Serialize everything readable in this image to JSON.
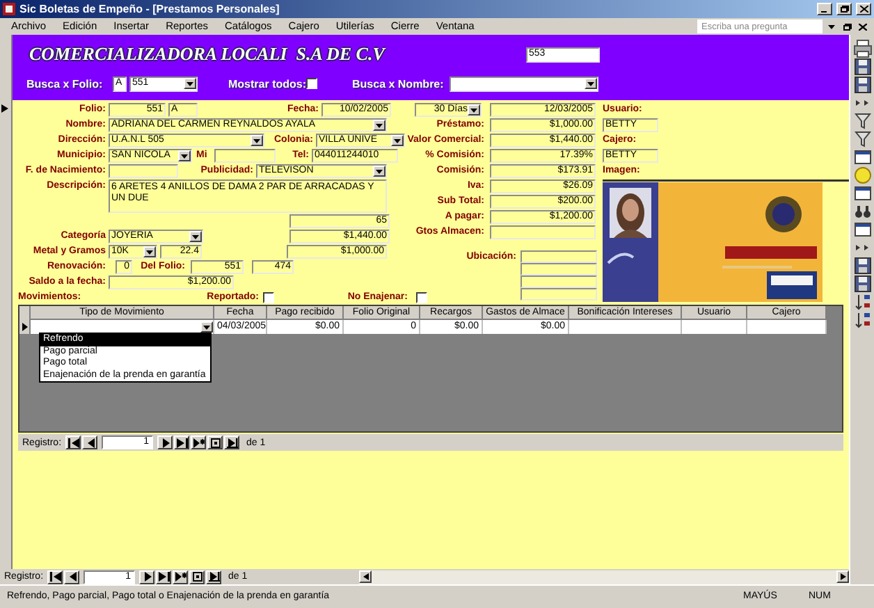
{
  "window": {
    "title": "Sic Boletas de Empeño - [Prestamos Personales]"
  },
  "menu": [
    "Archivo",
    "Edición",
    "Insertar",
    "Reportes",
    "Catálogos",
    "Cajero",
    "Utilerías",
    "Cierre",
    "Ventana"
  ],
  "help_box": {
    "placeholder": "Escriba una pregunta"
  },
  "header": {
    "company": "COMERCIALIZADORA LOCALI  S.A DE C.V",
    "record_number": "553",
    "folio_label": "Busca x Folio:",
    "folio_series": "A",
    "folio_value": "551",
    "show_all_label": "Mostrar todos:",
    "show_all_checked": false,
    "name_label": "Busca x Nombre:"
  },
  "form": {
    "left_rows": [
      [
        {
          "kind": "label",
          "text": "Folio:"
        },
        {
          "kind": "field",
          "value": "551"
        },
        {
          "kind": "field",
          "value": "A"
        },
        {
          "kind": "label",
          "text": "Fecha:"
        },
        {
          "kind": "field",
          "value": "10/02/2005"
        }
      ],
      [
        {
          "kind": "label",
          "text": "Nombre:"
        },
        {
          "kind": "combo",
          "value": "ADRIANA DEL CARMEN REYNALDOS AYALA"
        }
      ],
      [
        {
          "kind": "label",
          "text": "Dirección:"
        },
        {
          "kind": "combo",
          "value": "U.A.N.L 505"
        },
        {
          "kind": "label",
          "text": "Colonia:"
        },
        {
          "kind": "combo",
          "value": "VILLA UNIVE"
        }
      ],
      [
        {
          "kind": "label",
          "text": "Municipio:"
        },
        {
          "kind": "combo",
          "value": "SAN NICOLA"
        },
        {
          "kind": "label",
          "text": "Mi"
        },
        {
          "kind": "field"
        },
        {
          "kind": "label",
          "text": "Tel:"
        },
        {
          "kind": "field",
          "value": "044011244010"
        }
      ],
      [
        {
          "kind": "label",
          "text": "F. de Nacimiento:"
        },
        {
          "kind": "field"
        },
        {
          "kind": "label",
          "text": "Publicidad:"
        },
        {
          "kind": "combo",
          "value": "TELEVISON"
        }
      ],
      [
        {
          "kind": "label",
          "text": "Descripción:"
        },
        {
          "kind": "memo",
          "value": "6 ARETES 4 ANILLOS DE DAMA 2 PAR DE ARRACADAS Y UN DUE"
        }
      ],
      [
        {
          "kind": "field",
          "value": "65"
        }
      ],
      [
        {
          "kind": "label",
          "text": "Categoría"
        },
        {
          "kind": "combo",
          "value": "JOYERIA"
        },
        {
          "kind": "field",
          "value": "$1,440.00"
        }
      ],
      [
        {
          "kind": "label",
          "text": "Metal y Gramos"
        },
        {
          "kind": "combo",
          "value": "10K"
        },
        {
          "kind": "field",
          "value": "22.4"
        },
        {
          "kind": "field",
          "value": "$1,000.00"
        }
      ],
      [
        {
          "kind": "label",
          "text": "Renovación:"
        },
        {
          "kind": "field",
          "value": "0"
        },
        {
          "kind": "label",
          "text": "Del Folio:"
        },
        {
          "kind": "field",
          "value": "551"
        },
        {
          "kind": "field",
          "value": "474"
        }
      ],
      [
        {
          "kind": "label",
          "text": "Saldo a la fecha:"
        },
        {
          "kind": "field",
          "value": "$1,200.00"
        }
      ]
    ],
    "middle_rows": [
      [
        {
          "kind": "combo",
          "value": "30 Días"
        },
        {
          "kind": "field",
          "value": "12/03/2005"
        }
      ],
      [
        {
          "kind": "label",
          "text": "Préstamo:"
        },
        {
          "kind": "field",
          "value": "$1,000.00"
        }
      ],
      [
        {
          "kind": "label",
          "text": "Valor Comercial:"
        },
        {
          "kind": "field",
          "value": "$1,440.00"
        }
      ],
      [
        {
          "kind": "label",
          "text": "% Comisión:"
        },
        {
          "kind": "field",
          "value": "17.39%"
        }
      ],
      [
        {
          "kind": "label",
          "text": "Comisión:"
        },
        {
          "kind": "field",
          "value": "$173.91"
        }
      ],
      [
        {
          "kind": "label",
          "text": "Iva:"
        },
        {
          "kind": "field",
          "value": "$26.09"
        }
      ],
      [
        {
          "kind": "label",
          "text": "Sub Total:"
        },
        {
          "kind": "field",
          "value": "$200.00"
        }
      ],
      [
        {
          "kind": "label",
          "text": "A pagar:"
        },
        {
          "kind": "field",
          "value": "$1,200.00"
        }
      ],
      [
        {
          "kind": "label",
          "text": "Gtos Almacen:"
        },
        {
          "kind": "field"
        }
      ],
      [
        {
          "kind": "label",
          "text": "Ubicación:"
        },
        {
          "kind": "stack",
          "fields": [
            {
              "kind": "field"
            },
            {
              "kind": "field"
            },
            {
              "kind": "field"
            },
            {
              "kind": "field"
            }
          ]
        }
      ]
    ],
    "right_rows": [
      [
        {
          "kind": "label",
          "text": "Usuario:"
        }
      ],
      [
        {
          "kind": "field",
          "value": "BETTY"
        }
      ],
      [
        {
          "kind": "label",
          "text": "Cajero:"
        }
      ],
      [
        {
          "kind": "field",
          "value": "BETTY"
        }
      ],
      [
        {
          "kind": "label",
          "text": "Imagen:"
        }
      ],
      [
        {
          "kind": "picture"
        }
      ]
    ]
  },
  "movements": {
    "label": "Movimientos:",
    "reported": {
      "label": "Reportado:",
      "checked": false
    },
    "no_alienate": {
      "label": "No Enajenar:",
      "checked": false
    }
  },
  "datasheet": {
    "columns": [
      "Tipo de Movimiento",
      "Fecha",
      "Pago recibido",
      "Folio Original",
      "Recargos",
      "Gastos de Almace",
      "Bonificación Intereses",
      "Usuario",
      "Cajero"
    ],
    "rows": [
      {
        "cells": [
          {
            "kind": "combo"
          },
          {
            "kind": "text",
            "value": "04/03/2005"
          },
          {
            "kind": "text",
            "value": "$0.00"
          },
          {
            "kind": "text",
            "value": "0"
          },
          {
            "kind": "text",
            "value": "$0.00"
          },
          {
            "kind": "text",
            "value": "$0.00"
          },
          {
            "kind": "text"
          },
          {
            "kind": "text"
          },
          {
            "kind": "text"
          }
        ]
      }
    ],
    "dropdown": [
      {
        "text": "Refrendo",
        "selected": true
      },
      {
        "text": "Pago parcial",
        "selected": false
      },
      {
        "text": "Pago total",
        "selected": false
      },
      {
        "text": "Enajenación de la prenda en garantía",
        "selected": false
      }
    ],
    "navigation": {
      "label": "Registro:",
      "current": "1",
      "total": "de 1"
    }
  },
  "navigation": {
    "label": "Registro:",
    "current": "1",
    "total": "de 1"
  },
  "status_bar": {
    "message": "Refrendo, Pago parcial, Pago total o Enajenación de la prenda en garantía",
    "indicators": [
      "MAYÚS",
      "NUM"
    ]
  }
}
